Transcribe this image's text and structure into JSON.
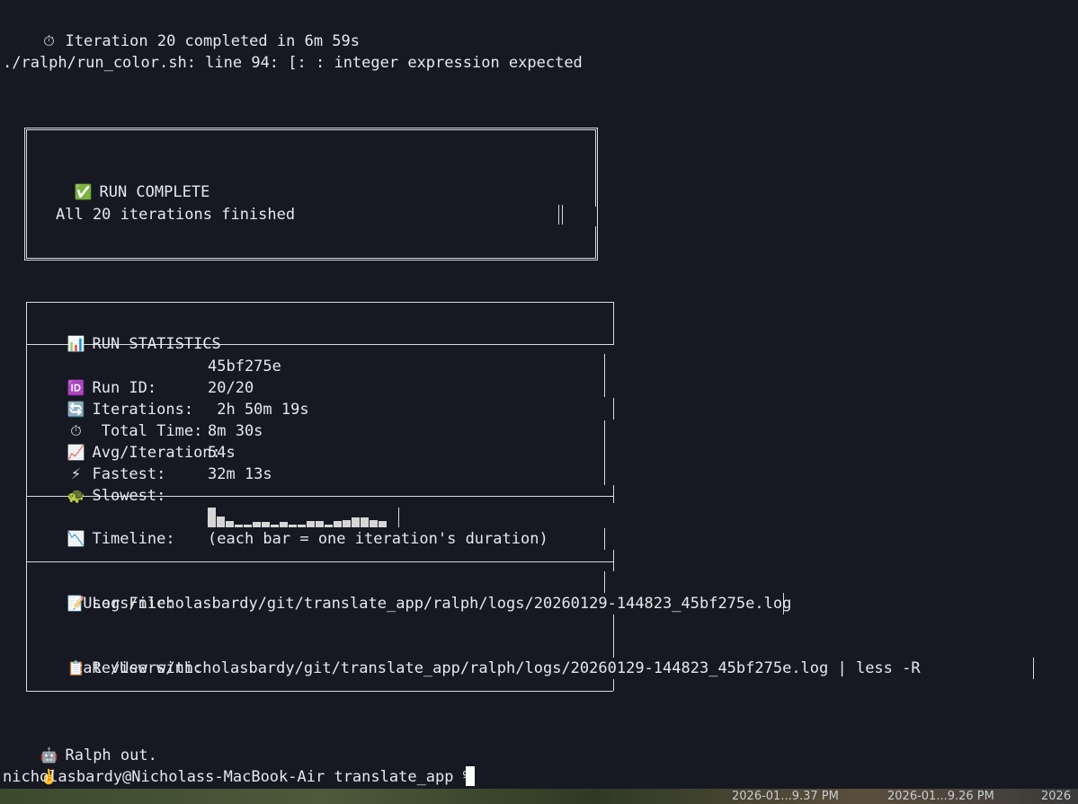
{
  "terminal": {
    "iteration_line": {
      "icon": "stopwatch-icon",
      "glyph": "⏱",
      "text": "Iteration 20 completed in 6m 59s"
    },
    "error_line": "./ralph/run_color.sh: line 94: [: : integer expression expected",
    "run_complete": {
      "icon": "check-mark-icon",
      "glyph": "✅",
      "title": "RUN COMPLETE",
      "subtitle": "All 20 iterations finished"
    },
    "run_statistics": {
      "icon": "bar-chart-icon",
      "glyph": "📊",
      "title": "RUN STATISTICS",
      "rows": [
        {
          "icon": "id-icon",
          "glyph": "🆔",
          "label": "Run ID:",
          "value": "45bf275e"
        },
        {
          "icon": "repeat-icon",
          "glyph": "🔄",
          "label": "Iterations:",
          "value": "20/20"
        },
        {
          "icon": "stopwatch-icon",
          "glyph": "⏱",
          "label": " Total Time:",
          "value": " 2h 50m 19s"
        },
        {
          "icon": "chart-increasing-icon",
          "glyph": "📈",
          "label": "Avg/Iteration:",
          "value": "8m 30s"
        },
        {
          "icon": "lightning-icon",
          "glyph": "⚡",
          "label": "Fastest:",
          "value": "54s"
        },
        {
          "icon": "turtle-icon",
          "glyph": "🐢",
          "label": "Slowest:",
          "value": "32m 13s"
        }
      ],
      "timeline": {
        "icon": "chart-decreasing-icon",
        "glyph": "📉",
        "label": "Timeline:",
        "note": "(each bar = one iteration's duration)",
        "bars": [
          1.0,
          0.55,
          0.3,
          0.15,
          0.15,
          0.25,
          0.25,
          0.15,
          0.25,
          0.15,
          0.15,
          0.3,
          0.3,
          0.15,
          0.3,
          0.35,
          0.5,
          0.5,
          0.35,
          0.3
        ]
      },
      "log_file": {
        "icon": "memo-icon",
        "glyph": "📝",
        "label": "Log File:",
        "path": "/Users/nicholasbardy/git/translate_app/ralph/logs/20260129-144823_45bf275e.log"
      },
      "review": {
        "icon": "clipboard-icon",
        "glyph": "📋",
        "label": "Review with:",
        "command": "cat /Users/nicholasbardy/git/translate_app/ralph/logs/20260129-144823_45bf275e.log | less -R"
      }
    },
    "signoff": {
      "icon": "robot-icon",
      "glyph": "🤖",
      "text": "Ralph out.",
      "trailing_glyph": "✌️",
      "trailing_icon": "victory-hand-icon"
    },
    "prompt": "nicholasbardy@Nicholass-MacBook-Air translate_app % "
  },
  "desktop_strip": {
    "labels": [
      "2026-01...9.37 PM",
      "2026-01...9.26 PM",
      "2026"
    ]
  }
}
